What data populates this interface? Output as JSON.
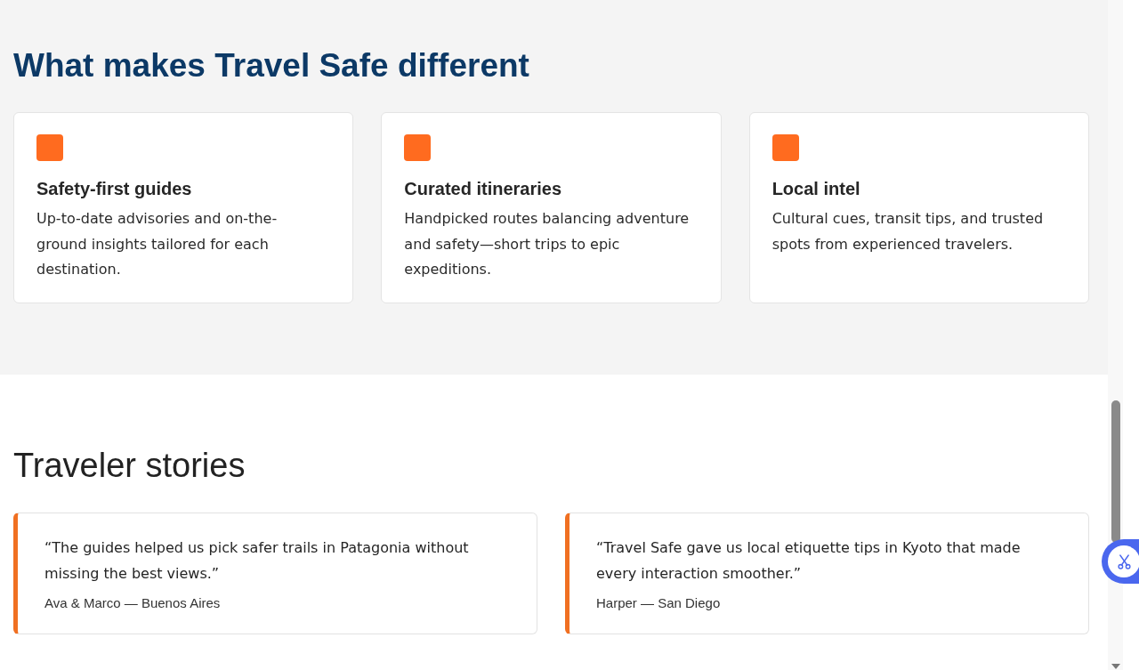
{
  "features": {
    "heading": "What makes Travel Safe different",
    "cards": [
      {
        "title": "Safety-first guides",
        "text": "Up-to-date advisories and on-the-ground insights tailored for each destination."
      },
      {
        "title": "Curated itineraries",
        "text": "Handpicked routes balancing adventure and safety—short trips to epic expeditions."
      },
      {
        "title": "Local intel",
        "text": "Cultural cues, transit tips, and trusted spots from experienced travelers."
      }
    ]
  },
  "stories": {
    "heading": "Traveler stories",
    "items": [
      {
        "quote": "“The guides helped us pick safer trails in Patagonia without missing the best views.”",
        "author": "Ava & Marco — Buenos Aires"
      },
      {
        "quote": "“Travel Safe gave us local etiquette tips in Kyoto that made every interaction smoother.”",
        "author": "Harper — San Diego"
      }
    ]
  }
}
